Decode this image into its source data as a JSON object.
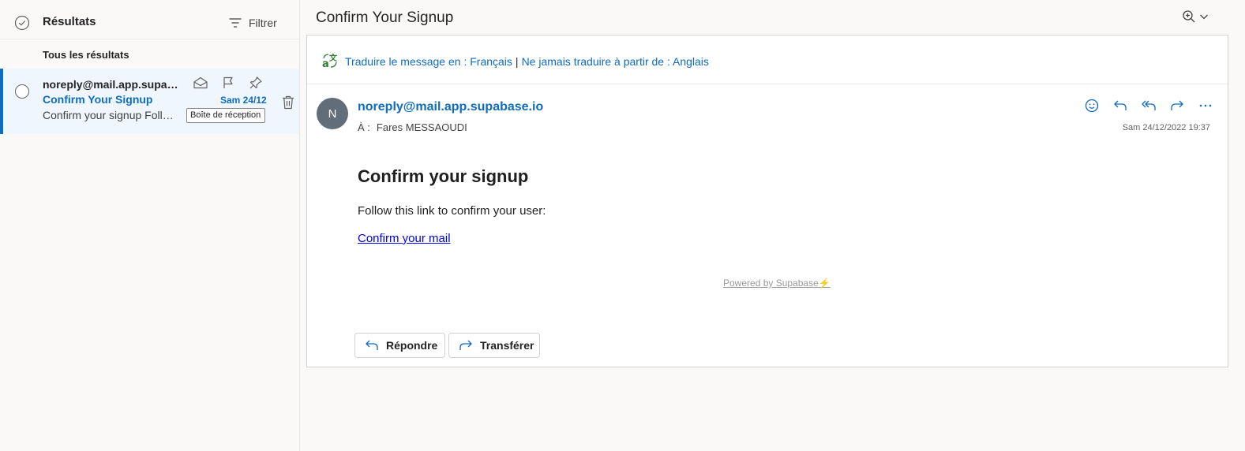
{
  "results_pane": {
    "title": "Résultats",
    "filter_label": "Filtrer",
    "section_label": "Tous les résultats"
  },
  "message_item": {
    "sender": "noreply@mail.app.supabase.io",
    "subject": "Confirm Your Signup",
    "date": "Sam 24/12",
    "preview": "Confirm your signup Follow this link to confirm your user:",
    "folder": "Boîte de réception"
  },
  "reading_pane": {
    "title": "Confirm Your Signup",
    "translate_prefix": "Traduire le message en : Français",
    "translate_separator": "|",
    "translate_never": "Ne jamais traduire à partir de : Anglais",
    "avatar_initial": "N",
    "sender_email": "noreply@mail.app.supabase.io",
    "to_label": "À :",
    "to_name": "Fares MESSAOUDI",
    "datetime": "Sam 24/12/2022 19:37",
    "body_title": "Confirm your signup",
    "body_text": "Follow this link to confirm your user:",
    "body_link": "Confirm your mail",
    "powered_by": "Powered by Supabase",
    "powered_bolt": "⚡",
    "reply_label": "Répondre",
    "forward_label": "Transférer"
  },
  "colors": {
    "accent": "#0f6cbd",
    "selected_bg": "#f0f6fd",
    "avatar_bg": "#616e79",
    "link": "#0000ee"
  },
  "icons": [
    "select-all-icon",
    "filter-icon",
    "mark-read-icon",
    "flag-icon",
    "pin-icon",
    "delete-icon",
    "zoom-icon",
    "chevron-down-icon",
    "translate-icon",
    "emoji-icon",
    "reply-icon",
    "reply-all-icon",
    "forward-icon",
    "more-icon"
  ]
}
